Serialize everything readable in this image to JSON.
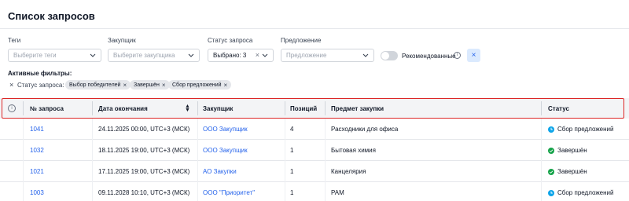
{
  "page": {
    "title": "Список запросов"
  },
  "filters": {
    "tags": {
      "label": "Теги",
      "placeholder": "Выберите теги"
    },
    "buyer": {
      "label": "Закупщик",
      "placeholder": "Выберите закупщика"
    },
    "status": {
      "label": "Статус запроса",
      "value": "Выбрано: 3"
    },
    "offer": {
      "label": "Предложение",
      "placeholder": "Предложение"
    },
    "recommended": {
      "label": "Рекомендованные",
      "enabled": false
    },
    "clear_icon": "close-icon"
  },
  "active_filters": {
    "label": "Активные фильтры:",
    "group_label": "Статус запроса:",
    "chips": [
      "Выбор победителей",
      "Завершён",
      "Сбор предложений"
    ]
  },
  "table": {
    "columns": [
      "№ запроса",
      "Дата окончания",
      "Закупщик",
      "Позиций",
      "Предмет закупки",
      "Статус"
    ],
    "rows": [
      {
        "id": "1041",
        "end_date": "24.11.2025 00:00, UTC+3 (МСК)",
        "buyer": "ООО Закупщик",
        "positions": "4",
        "subject": "Расходники для офиса",
        "status": "Сбор предложений",
        "status_kind": "collecting"
      },
      {
        "id": "1032",
        "end_date": "18.11.2025 19:00, UTC+3 (МСК)",
        "buyer": "ООО Закупщик",
        "positions": "1",
        "subject": "Бытовая химия",
        "status": "Завершён",
        "status_kind": "done"
      },
      {
        "id": "1021",
        "end_date": "17.11.2025 19:00, UTC+3 (МСК)",
        "buyer": "АО Закупки",
        "positions": "1",
        "subject": "Канцелярия",
        "status": "Завершён",
        "status_kind": "done"
      },
      {
        "id": "1003",
        "end_date": "09.11.2028 10:10, UTC+3 (МСК)",
        "buyer": "ООО \"Приоритет\"",
        "positions": "1",
        "subject": "РАМ",
        "status": "Сбор предложений",
        "status_kind": "collecting"
      }
    ]
  },
  "colors": {
    "link": "#2563eb",
    "collecting": "#0ea5e9",
    "done": "#16a34a",
    "highlight": "#dc2626"
  }
}
